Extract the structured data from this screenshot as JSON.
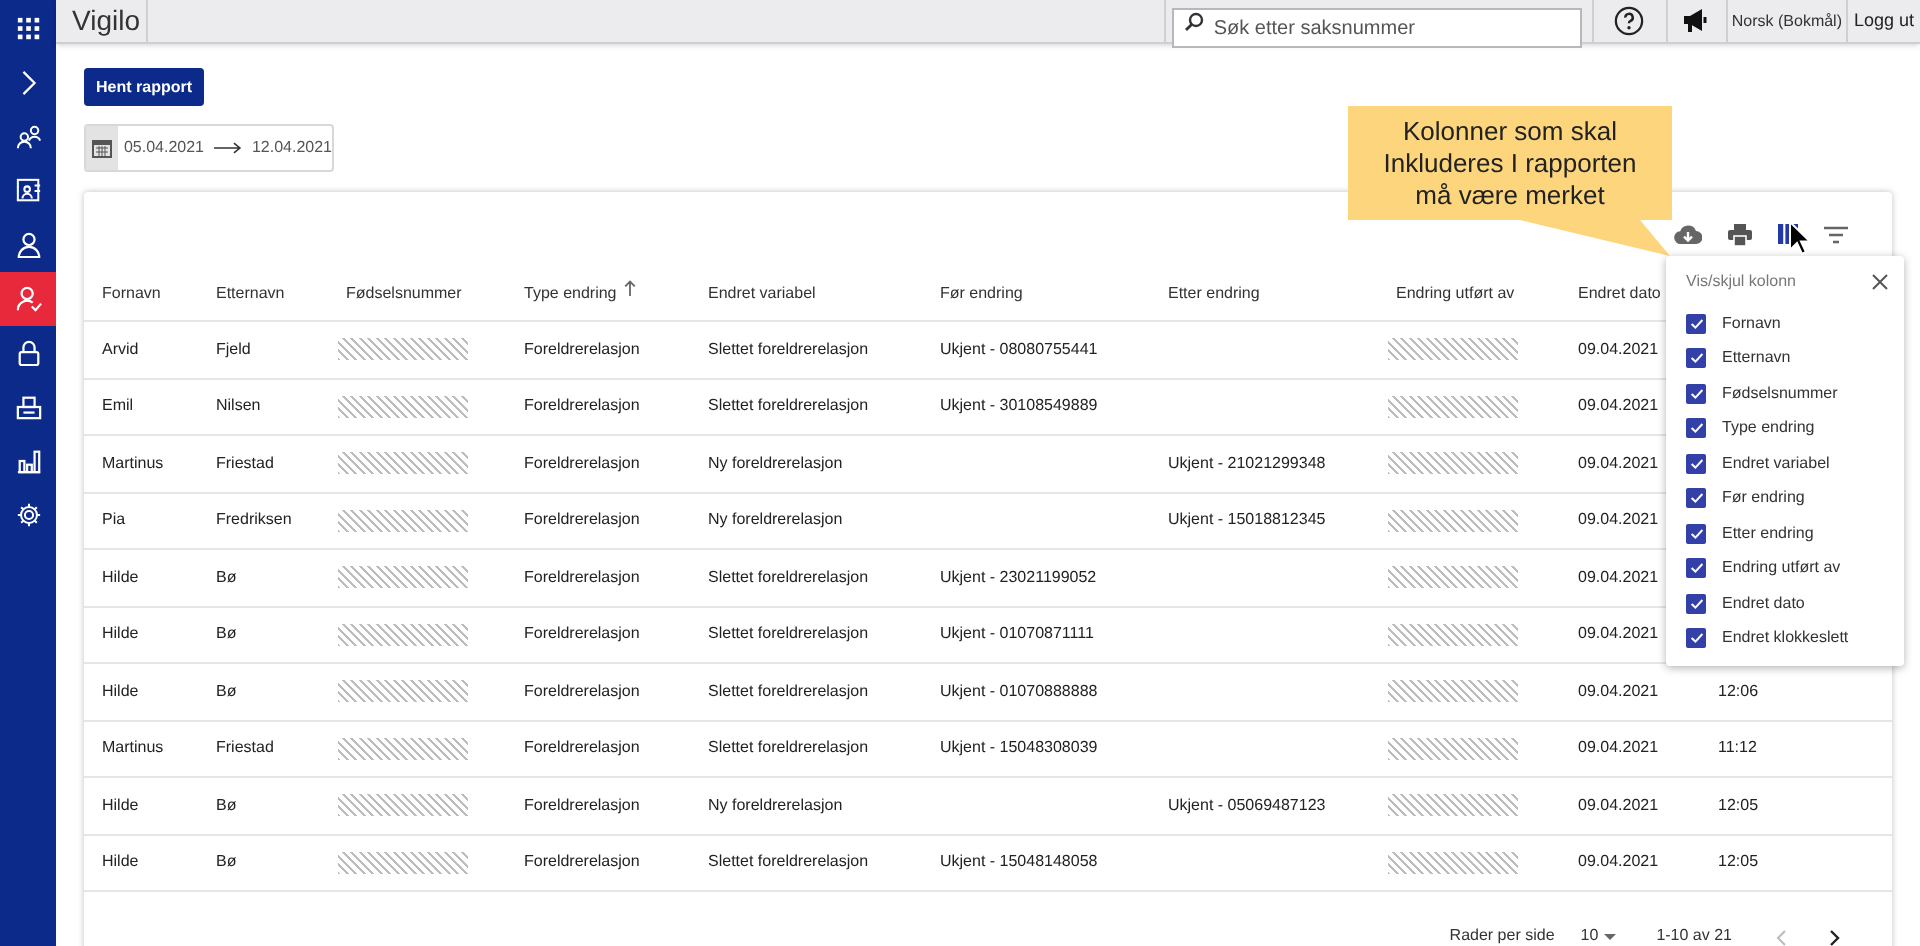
{
  "app": {
    "title": "Vigilo"
  },
  "sidebar": {
    "items": [
      {
        "kind": "apps",
        "selected": false
      },
      {
        "kind": "expand",
        "selected": false
      },
      {
        "kind": "group",
        "selected": false
      },
      {
        "kind": "report",
        "selected": false
      },
      {
        "kind": "person",
        "selected": false
      },
      {
        "kind": "person-check",
        "selected": true
      },
      {
        "kind": "lock",
        "selected": false
      },
      {
        "kind": "tray",
        "selected": false
      },
      {
        "kind": "chart",
        "selected": false
      },
      {
        "kind": "settings",
        "selected": false
      }
    ]
  },
  "header": {
    "search": {
      "placeholder": "Søk etter saksnummer"
    },
    "language": "Norsk (Bokmål)",
    "logout": "Logg ut"
  },
  "report_button": "Hent rapport",
  "date_range": {
    "from": "05.04.2021",
    "to": "12.04.2021"
  },
  "callout": "Kolonner som skal Inkluderes I rapporten må være merket",
  "table": {
    "columns": [
      {
        "label": "Fornavn",
        "kind": "text"
      },
      {
        "label": "Etternavn",
        "kind": "text"
      },
      {
        "label": "Fødselsnummer",
        "kind": "masked"
      },
      {
        "label": "Type endring",
        "kind": "text",
        "sorted": true
      },
      {
        "label": "Endret variabel",
        "kind": "text"
      },
      {
        "label": "Før endring",
        "kind": "text"
      },
      {
        "label": "Etter endring",
        "kind": "text"
      },
      {
        "label": "Endring utført av",
        "kind": "masked"
      },
      {
        "label": "Endret dato",
        "kind": "text"
      },
      {
        "kind": "text"
      }
    ],
    "rows": [
      {
        "cells": [
          "Arvid",
          "Fjeld",
          null,
          "Foreldrerelasjon",
          "Slettet foreldrerelasjon",
          "Ukjent - 08080755441",
          null,
          null,
          "09.04.2021",
          null
        ]
      },
      {
        "cells": [
          "Emil",
          "Nilsen",
          null,
          "Foreldrerelasjon",
          "Slettet foreldrerelasjon",
          "Ukjent - 30108549889",
          null,
          null,
          "09.04.2021",
          null
        ]
      },
      {
        "cells": [
          "Martinus",
          "Friestad",
          null,
          "Foreldrerelasjon",
          "Ny foreldrerelasjon",
          null,
          "Ukjent - 21021299348",
          null,
          "09.04.2021",
          null
        ]
      },
      {
        "cells": [
          "Pia",
          "Fredriksen",
          null,
          "Foreldrerelasjon",
          "Ny foreldrerelasjon",
          null,
          "Ukjent - 15018812345",
          null,
          "09.04.2021",
          null
        ]
      },
      {
        "cells": [
          "Hilde",
          "Bø",
          null,
          "Foreldrerelasjon",
          "Slettet foreldrerelasjon",
          "Ukjent - 23021199052",
          null,
          null,
          "09.04.2021",
          null
        ]
      },
      {
        "cells": [
          "Hilde",
          "Bø",
          null,
          "Foreldrerelasjon",
          "Slettet foreldrerelasjon",
          "Ukjent - 01070871111",
          null,
          null,
          "09.04.2021",
          null
        ]
      },
      {
        "cells": [
          "Hilde",
          "Bø",
          null,
          "Foreldrerelasjon",
          "Slettet foreldrerelasjon",
          "Ukjent - 01070888888",
          null,
          null,
          "09.04.2021",
          "12:06"
        ]
      },
      {
        "cells": [
          "Martinus",
          "Friestad",
          null,
          "Foreldrerelasjon",
          "Slettet foreldrerelasjon",
          "Ukjent - 15048308039",
          null,
          null,
          "09.04.2021",
          "11:12"
        ]
      },
      {
        "cells": [
          "Hilde",
          "Bø",
          null,
          "Foreldrerelasjon",
          "Ny foreldrerelasjon",
          null,
          "Ukjent - 05069487123",
          null,
          "09.04.2021",
          "12:05"
        ]
      },
      {
        "cells": [
          "Hilde",
          "Bø",
          null,
          "Foreldrerelasjon",
          "Slettet foreldrerelasjon",
          "Ukjent - 15048148058",
          null,
          null,
          "09.04.2021",
          "12:05"
        ]
      }
    ]
  },
  "pagination": {
    "label": "Rader per side",
    "rows_per_page": "10",
    "range": "1-10 av 21"
  },
  "column_menu": {
    "title": "Vis/skjul kolonn",
    "items": [
      {
        "label": "Fornavn",
        "checked": true
      },
      {
        "label": "Etternavn",
        "checked": true
      },
      {
        "label": "Fødselsnummer",
        "checked": true
      },
      {
        "label": "Type endring",
        "checked": true
      },
      {
        "label": "Endret variabel",
        "checked": true
      },
      {
        "label": "Før endring",
        "checked": true
      },
      {
        "label": "Etter endring",
        "checked": true
      },
      {
        "label": "Endring utført av",
        "checked": true
      },
      {
        "label": "Endret dato",
        "checked": true
      },
      {
        "label": "Endret klokkeslett",
        "checked": true
      }
    ]
  }
}
